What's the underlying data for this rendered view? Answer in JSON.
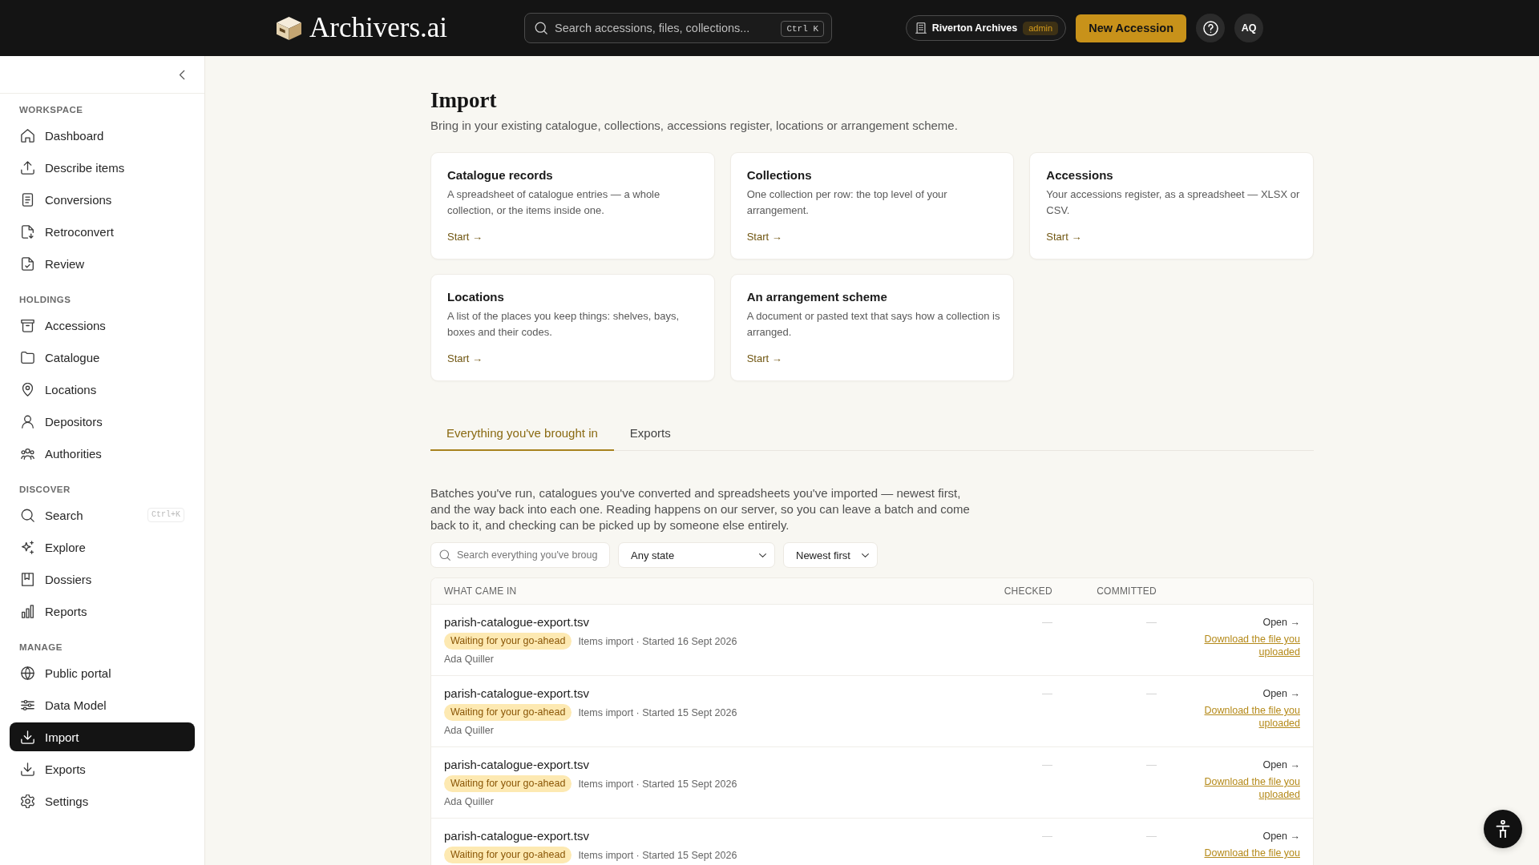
{
  "header": {
    "logo": "Archivers.ai",
    "search": {
      "placeholder": "Search accessions, files, collections...",
      "shortcut": "Ctrl K"
    },
    "workspace": {
      "name": "Riverton Archives",
      "role": "admin"
    },
    "new_button": "New Accession",
    "avatar": "AQ"
  },
  "sidebar": {
    "sections": [
      {
        "title": "WORKSPACE",
        "items": [
          {
            "label": "Dashboard",
            "selected": false
          },
          {
            "label": "Describe items",
            "selected": false
          },
          {
            "label": "Conversions",
            "selected": false
          },
          {
            "label": "Retroconvert",
            "selected": false
          },
          {
            "label": "Review",
            "selected": false
          }
        ]
      },
      {
        "title": "HOLDINGS",
        "items": [
          {
            "label": "Accessions",
            "selected": false
          },
          {
            "label": "Catalogue",
            "selected": false
          },
          {
            "label": "Locations",
            "selected": false
          },
          {
            "label": "Depositors",
            "selected": false
          },
          {
            "label": "Authorities",
            "selected": false
          }
        ]
      },
      {
        "title": "DISCOVER",
        "items": [
          {
            "label": "Search",
            "selected": false,
            "shortcut": "Ctrl+K"
          },
          {
            "label": "Explore",
            "selected": false
          },
          {
            "label": "Dossiers",
            "selected": false
          },
          {
            "label": "Reports",
            "selected": false
          }
        ]
      },
      {
        "title": "MANAGE",
        "items": [
          {
            "label": "Public portal",
            "selected": false
          },
          {
            "label": "Data Model",
            "selected": false
          },
          {
            "label": "Import",
            "selected": true
          },
          {
            "label": "Exports",
            "selected": false
          },
          {
            "label": "Settings",
            "selected": false
          }
        ]
      }
    ]
  },
  "page": {
    "title": "Import",
    "subtitle": "Bring in your existing catalogue, collections, accessions register, locations or arrangement scheme."
  },
  "import_options": [
    {
      "title": "Catalogue records",
      "description": "A spreadsheet of catalogue entries — a whole collection, or the items inside one.",
      "link": "Start →"
    },
    {
      "title": "Collections",
      "description": "One collection per row: the top level of your arrangement.",
      "link": "Start →"
    },
    {
      "title": "Accessions",
      "description": "Your accessions register, as a spreadsheet — XLSX or CSV.",
      "link": "Start →"
    },
    {
      "title": "Locations",
      "description": "A list of the places you keep things: shelves, bays, boxes and their codes.",
      "link": "Start →"
    },
    {
      "title": "An arrangement scheme",
      "description": "A document or pasted text that says how a collection is arranged.",
      "link": "Start →"
    }
  ],
  "tabs": [
    {
      "label": "Everything you've brought in",
      "selected": true
    },
    {
      "label": "Exports",
      "selected": false
    }
  ],
  "history": {
    "description": "Batches you've run, catalogues you've converted and spreadsheets you've imported — newest first, and the way back into each one. Reading happens on our server, so you can leave a batch and come back to it, and checking can be picked up by someone else entirely.",
    "search": {
      "placeholder": "Search everything you've broug"
    },
    "state_filter": "Any state",
    "sort": "Newest first",
    "table": {
      "columns": [
        "WHAT CAME IN",
        "CHECKED",
        "COMMITTED"
      ],
      "rows": [
        {
          "file": "parish-catalogue-export.tsv",
          "status": "Waiting for your go-ahead",
          "details": "Items import · Started 16 Sept 2026",
          "author": "Ada Quiller",
          "checked": "—",
          "committed": "—",
          "open": "Open →",
          "download": "Download the file you uploaded"
        },
        {
          "file": "parish-catalogue-export.tsv",
          "status": "Waiting for your go-ahead",
          "details": "Items import · Started 15 Sept 2026",
          "author": "Ada Quiller",
          "checked": "—",
          "committed": "—",
          "open": "Open →",
          "download": "Download the file you uploaded"
        },
        {
          "file": "parish-catalogue-export.tsv",
          "status": "Waiting for your go-ahead",
          "details": "Items import · Started 15 Sept 2026",
          "author": "Ada Quiller",
          "checked": "—",
          "committed": "—",
          "open": "Open →",
          "download": "Download the file you uploaded"
        },
        {
          "file": "parish-catalogue-export.tsv",
          "status": "Waiting for your go-ahead",
          "details": "Items import · Started 15 Sept 2026",
          "checked": "—",
          "committed": "—",
          "open": "Open →",
          "download": "Download the file you"
        }
      ]
    }
  }
}
